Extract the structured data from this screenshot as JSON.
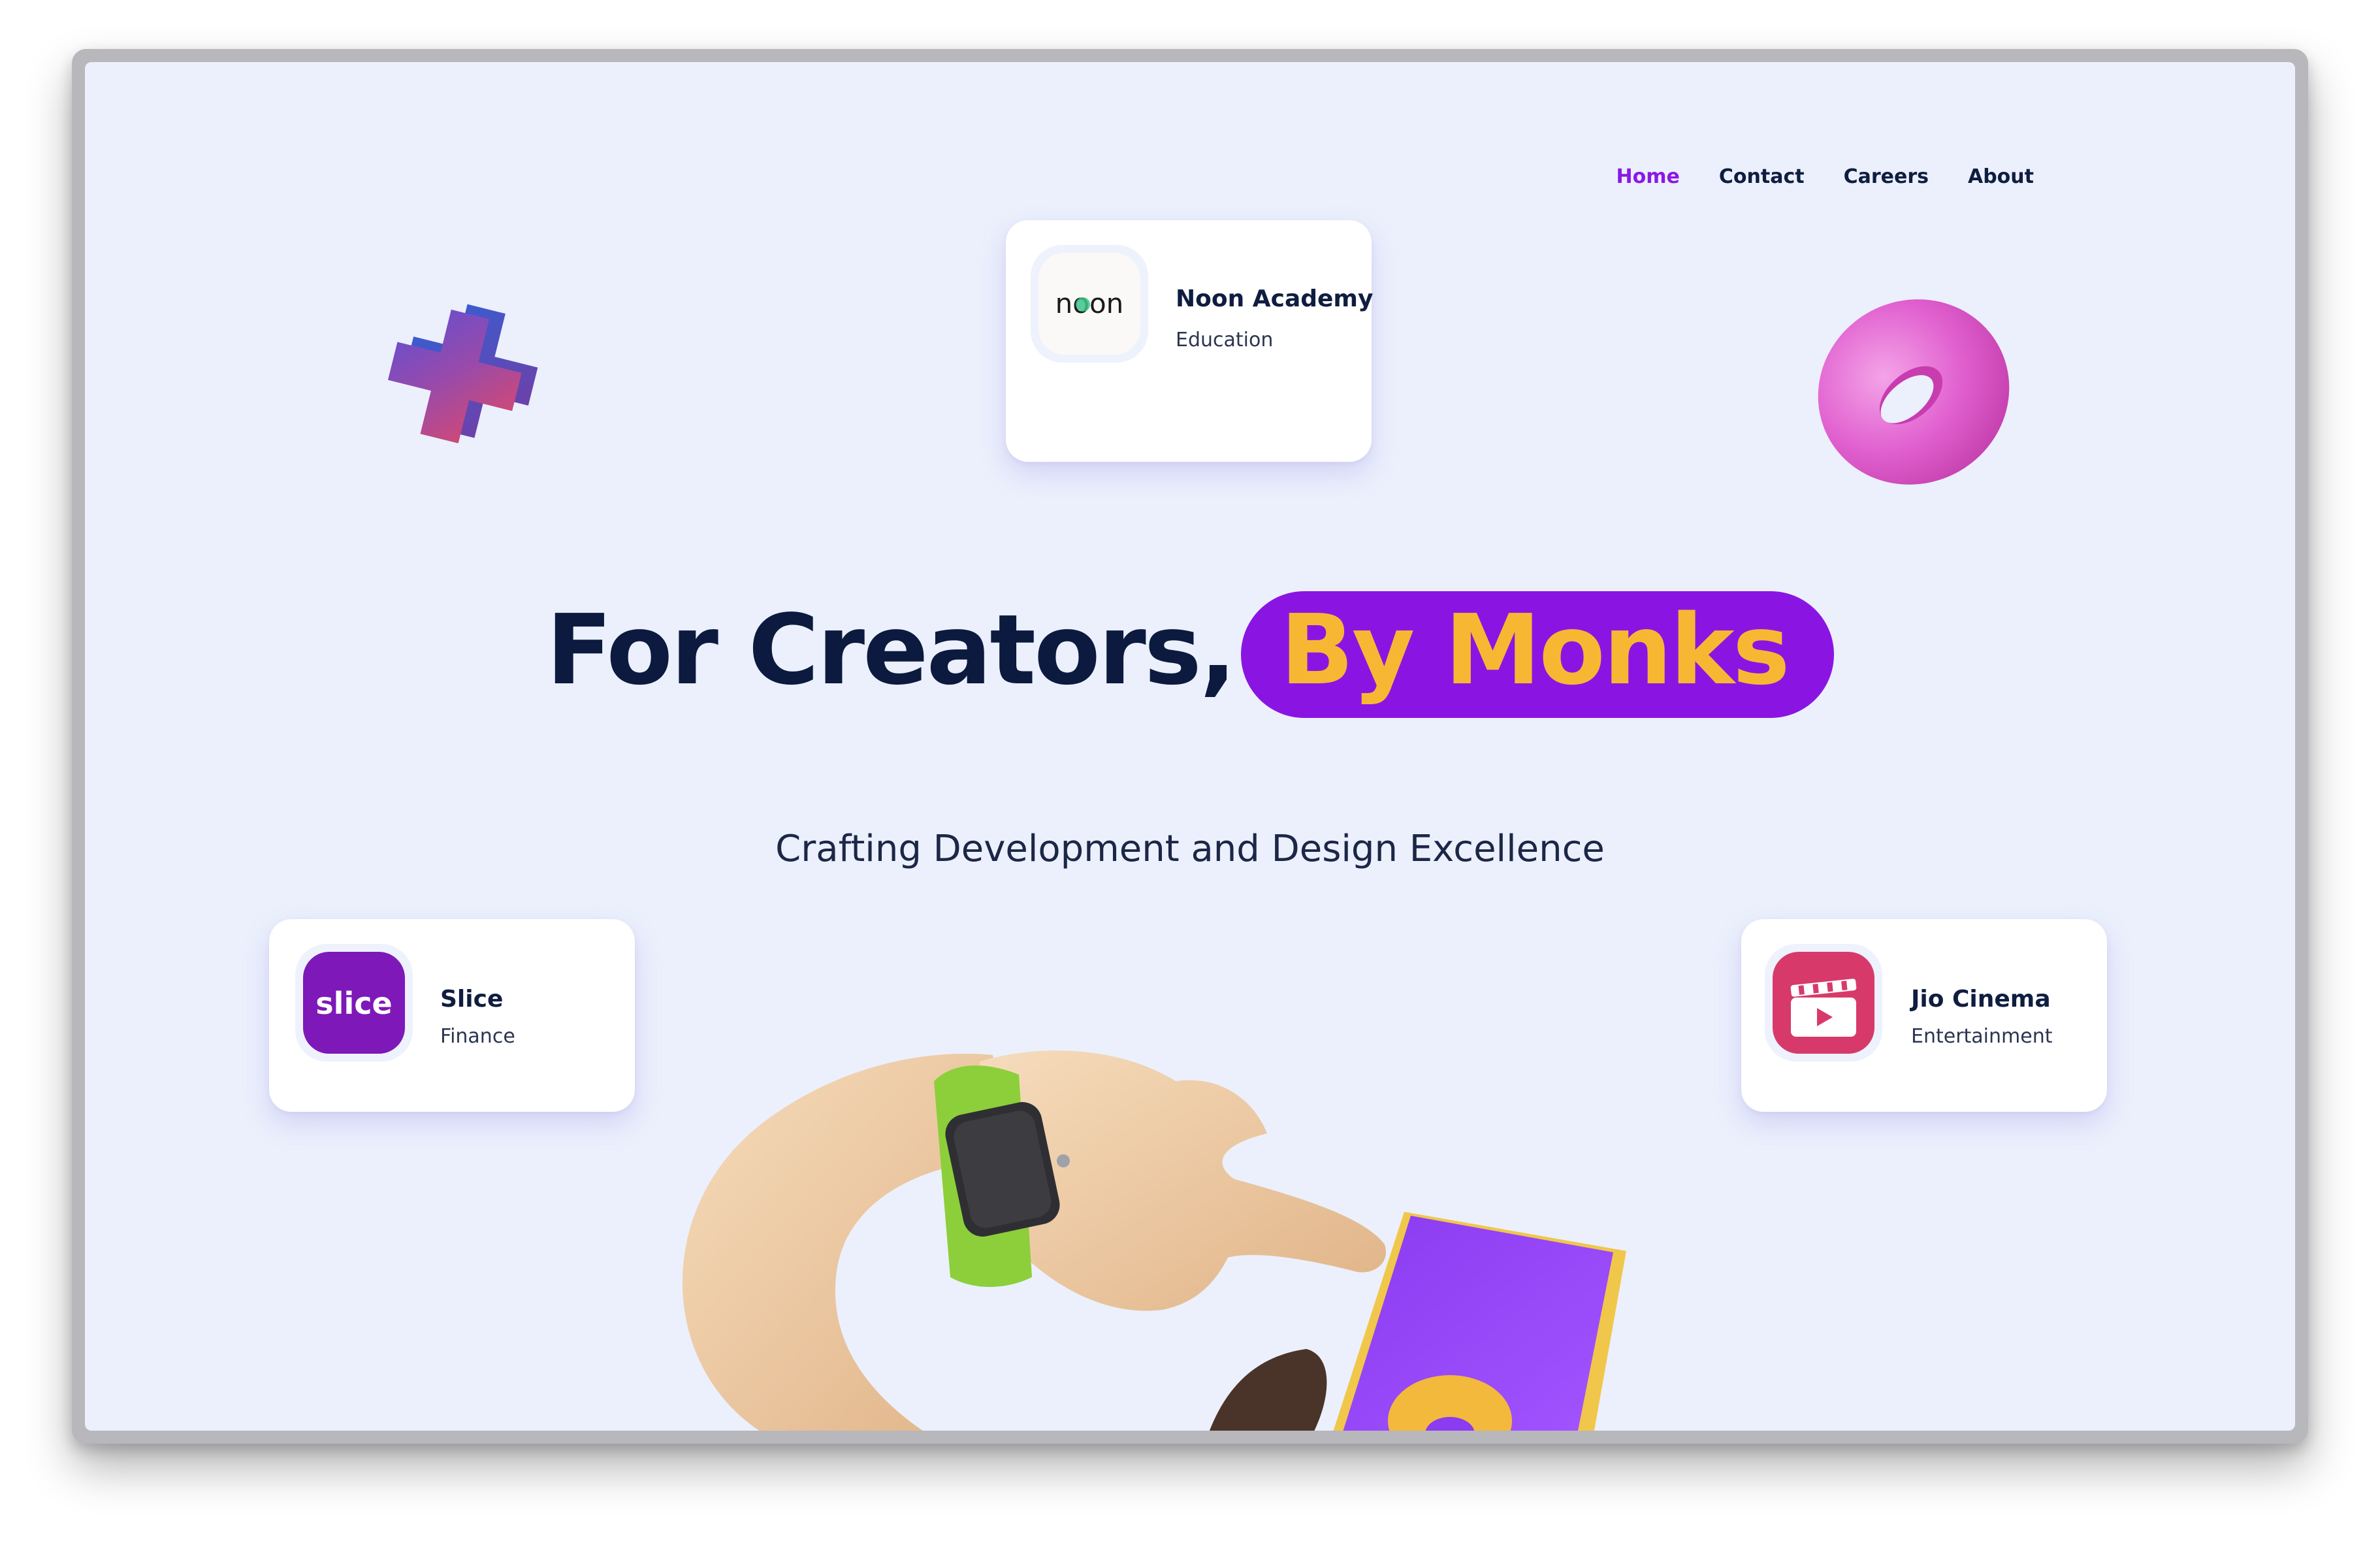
{
  "nav": {
    "items": [
      {
        "label": "Home",
        "active": true
      },
      {
        "label": "Contact",
        "active": false
      },
      {
        "label": "Careers",
        "active": false
      },
      {
        "label": "About",
        "active": false
      }
    ]
  },
  "hero": {
    "title_part1": "For Creators,",
    "title_highlight": "By Monks",
    "tagline": "Crafting Development and Design Excellence"
  },
  "clients": {
    "noon": {
      "name": "Noon Academy",
      "category": "Education",
      "logo_text": "noon"
    },
    "slice": {
      "name": "Slice",
      "category": "Finance",
      "logo_text": "slice"
    },
    "jio": {
      "name": "Jio Cinema",
      "category": "Entertainment"
    }
  },
  "colors": {
    "accent_purple": "#8a15e3",
    "accent_yellow": "#f8b733",
    "navy": "#0b1a3e",
    "background": "#ebf0fc"
  },
  "icons": {
    "plus": "plus-3d-icon",
    "torus": "torus-3d-icon",
    "hand": "hand-with-smartwatch-and-phone-illustration"
  }
}
